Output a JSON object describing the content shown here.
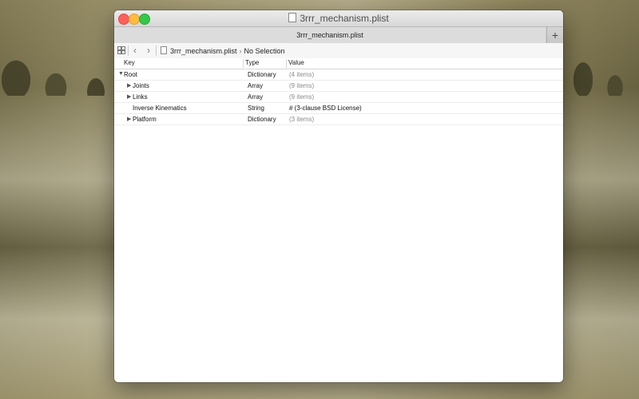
{
  "window": {
    "title": "3rrr_mechanism.plist",
    "tab_label": "3rrr_mechanism.plist",
    "add_tab_label": "+"
  },
  "toolbar": {
    "back_label": "‹",
    "forward_label": "›",
    "breadcrumb_file": "3rrr_mechanism.plist",
    "breadcrumb_separator": "›",
    "breadcrumb_selection": "No Selection"
  },
  "table": {
    "columns": [
      "Key",
      "Type",
      "Value"
    ],
    "rows": [
      {
        "key": "Root",
        "type": "Dictionary",
        "value": "(4 items)",
        "disclosure": "▼",
        "indent": 0
      },
      {
        "key": "Joints",
        "type": "Array",
        "value": "(9 items)",
        "disclosure": "▶",
        "indent": 1
      },
      {
        "key": "Links",
        "type": "Array",
        "value": "(9 items)",
        "disclosure": "▶",
        "indent": 1
      },
      {
        "key": "Inverse Kinematics",
        "type": "String",
        "value": "# (3-clause BSD License)",
        "disclosure": "",
        "indent": 1
      },
      {
        "key": "Platform",
        "type": "Dictionary",
        "value": "(3 items)",
        "disclosure": "▶",
        "indent": 1
      }
    ]
  }
}
